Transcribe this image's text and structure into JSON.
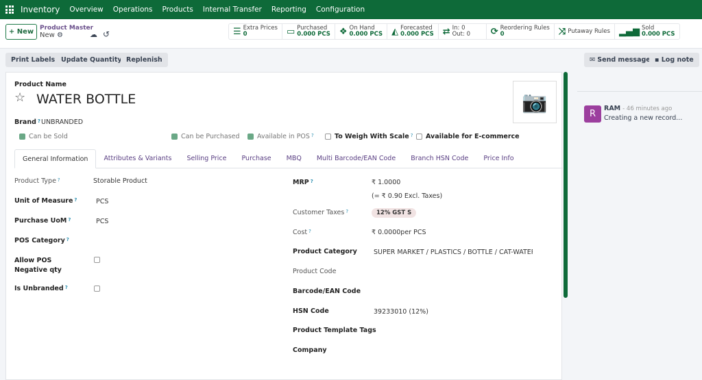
{
  "navbar": {
    "app": "Inventory",
    "menu": [
      "Overview",
      "Operations",
      "Products",
      "Internal Transfer",
      "Reporting",
      "Configuration"
    ]
  },
  "control": {
    "new_label": "New",
    "breadcrumb": "Product Master",
    "record": "New"
  },
  "stats": [
    {
      "icon": "list-icon",
      "title": "Extra Prices",
      "value": "0"
    },
    {
      "icon": "credit-card-icon",
      "title": "Purchased",
      "value": "0.000 PCS"
    },
    {
      "icon": "cubes-icon",
      "title": "On Hand",
      "value": "0.000 PCS"
    },
    {
      "icon": "area-chart-icon",
      "title": "Forecasted",
      "value": "0.000 PCS"
    },
    {
      "icon": "exchange-icon",
      "title": "In: 0",
      "value": "Out: 0"
    },
    {
      "icon": "refresh-icon",
      "title": "Reordering Rules",
      "value": "0"
    },
    {
      "icon": "random-icon",
      "title": "Putaway Rules",
      "value": ""
    },
    {
      "icon": "signal-icon",
      "title": "Sold",
      "value": "0.000 PCS"
    }
  ],
  "actions": {
    "print": "Print Labels",
    "update": "Update Quantity",
    "replenish": "Replenish",
    "send": "Send message",
    "log": "Log note"
  },
  "form": {
    "name_label": "Product Name",
    "name": "WATER BOTTLE",
    "brand_label": "Brand",
    "brand": "UNBRANDED",
    "checks": {
      "sold": "Can be Sold",
      "purchased": "Can be Purchased",
      "pos": "Available in POS",
      "scale": "To Weigh With Scale",
      "ecom": "Available for E-commerce"
    },
    "tabs": [
      "General Information",
      "Attributes & Variants",
      "Selling Price",
      "Purchase",
      "MBQ",
      "Multi Barcode/EAN Code",
      "Branch HSN Code",
      "Price Info"
    ],
    "left": {
      "type_label": "Product Type",
      "type": "Storable Product",
      "uom_label": "Unit of Measure",
      "uom": "PCS",
      "puom_label": "Purchase UoM",
      "puom": "PCS",
      "poscat_label": "POS Category",
      "posneg_label": "Allow POS Negative qty",
      "unbranded_label": "Is Unbranded"
    },
    "right": {
      "mrp_label": "MRP",
      "mrp": "₹ 1.0000",
      "mrp_excl": "(= ₹ 0.90 Excl. Taxes)",
      "tax_label": "Customer Taxes",
      "tax": "12% GST S",
      "cost_label": "Cost",
      "cost": "₹ 0.0000per PCS",
      "categ_label": "Product Category",
      "categ": "SUPER MARKET / PLASTICS / BOTTLE / CAT-WATER B",
      "code_label": "Product Code",
      "barcode_label": "Barcode/EAN Code",
      "hsn_label": "HSN Code",
      "hsn": "39233010 (12%)",
      "tags_label": "Product Template Tags",
      "company_label": "Company"
    }
  },
  "chatter": {
    "author": "RAM",
    "initial": "R",
    "time": "- 46 minutes ago",
    "message": "Creating a new record..."
  }
}
